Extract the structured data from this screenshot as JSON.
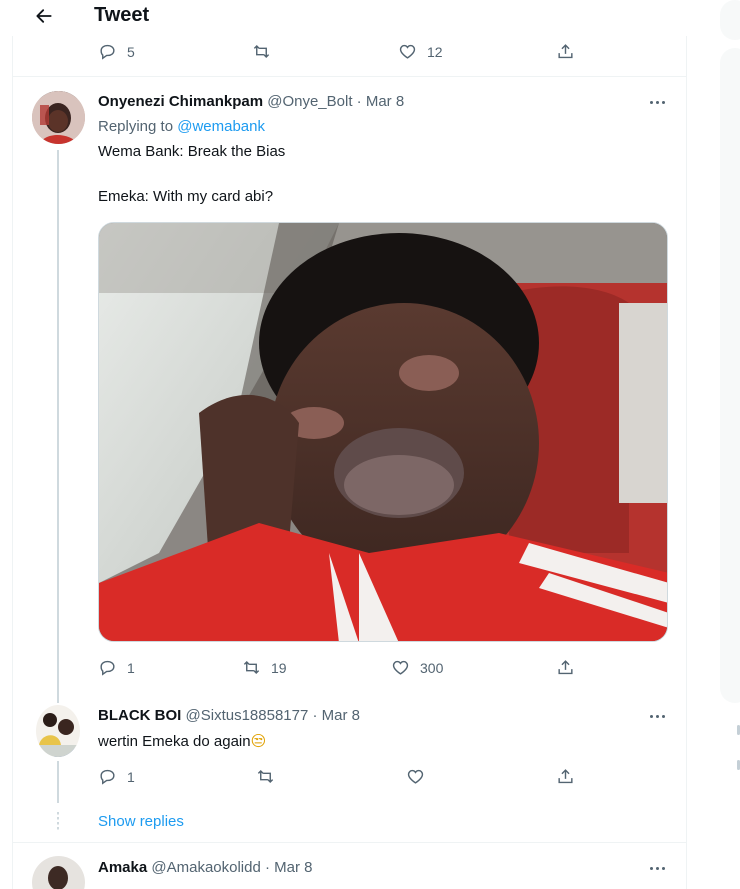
{
  "header": {
    "title": "Tweet"
  },
  "top_tweet_actions": {
    "replies": "5",
    "retweets": "",
    "likes": "12"
  },
  "main_tweet": {
    "name": "Onyenezi Chimankpam",
    "handle": "@Onye_Bolt",
    "sep": "·",
    "date": "Mar 8",
    "replying_prefix": "Replying to",
    "replying_to": "@wemabank",
    "line1": "Wema Bank: Break the Bias",
    "line2": "Emeka: With my card abi?",
    "replies": "1",
    "retweets": "19",
    "likes": "300"
  },
  "reply_tweet": {
    "name": "BLACK BOI",
    "handle": "@Sixtus18858177",
    "sep": "·",
    "date": "Mar 8",
    "text": "wertin Emeka do again",
    "emoji": "😒",
    "replies": "1",
    "retweets": "",
    "likes": ""
  },
  "show_replies": "Show replies",
  "bottom_tweet": {
    "name": "Amaka",
    "handle": "@Amakaokolidd",
    "sep": "·",
    "date": "Mar 8"
  },
  "icons": {
    "back": "arrow-left-icon",
    "reply": "reply-icon",
    "retweet": "retweet-icon",
    "like": "heart-icon",
    "share": "share-icon",
    "more": "more-icon"
  },
  "colors": {
    "accent": "#1d9bf0",
    "text": "#0f1419",
    "muted": "#536471",
    "border": "#cfd9de"
  }
}
